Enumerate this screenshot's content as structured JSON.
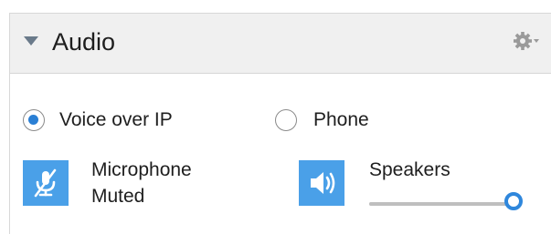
{
  "panel": {
    "title": "Audio",
    "icons": {
      "collapse": "collapse-triangle-icon",
      "settings": "gear-dropdown-icon"
    }
  },
  "audio_mode": {
    "selected": "voip",
    "options": [
      {
        "id": "voip",
        "label": "Voice over IP",
        "checked": true
      },
      {
        "id": "phone",
        "label": "Phone",
        "checked": false
      }
    ]
  },
  "microphone": {
    "label_line1": "Microphone",
    "label_line2": "Muted",
    "muted": true,
    "icon": "microphone-muted-icon"
  },
  "speakers": {
    "label": "Speakers",
    "icon": "speaker-volume-icon",
    "volume_fraction": 1.0
  },
  "colors": {
    "accent": "#2f87dc",
    "tile_blue": "#4aa0e8",
    "header_bg": "#f0f0f0"
  }
}
